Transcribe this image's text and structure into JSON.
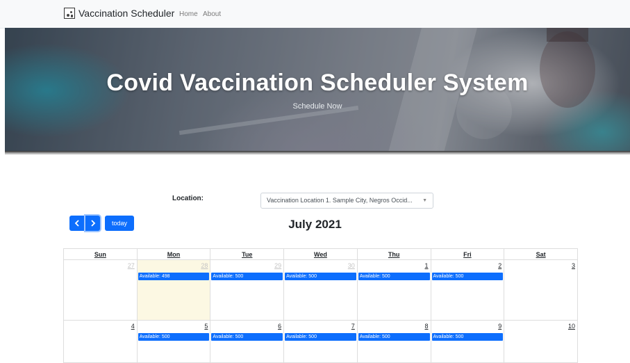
{
  "navbar": {
    "brand": "Vaccination Scheduler",
    "links": [
      "Home",
      "About"
    ]
  },
  "hero": {
    "title": "Covid Vaccination Scheduler System",
    "subtitle": "Schedule Now"
  },
  "location": {
    "label": "Location:",
    "selected": "Vaccination Location 1. Sample City, Negros Occid..."
  },
  "toolbar": {
    "prev_icon": "chevron-left",
    "next_icon": "chevron-right",
    "prev_label": "‹",
    "next_label": "›",
    "today_label": "today",
    "title": "July 2021"
  },
  "calendar": {
    "headers": [
      "Sun",
      "Mon",
      "Tue",
      "Wed",
      "Thu",
      "Fri",
      "Sat"
    ],
    "weeks": [
      [
        {
          "day": "27",
          "event": ""
        },
        {
          "day": "28",
          "event": "Available: 498"
        },
        {
          "day": "29",
          "event": "Available: 500"
        },
        {
          "day": "30",
          "event": "Available: 500"
        },
        {
          "day": "1",
          "event": "Available: 500"
        },
        {
          "day": "2",
          "event": "Available: 500"
        },
        {
          "day": "3",
          "event": ""
        }
      ],
      [
        {
          "day": "4",
          "event": ""
        },
        {
          "day": "5",
          "event": "Available: 500"
        },
        {
          "day": "6",
          "event": "Available: 500"
        },
        {
          "day": "7",
          "event": "Available: 500"
        },
        {
          "day": "8",
          "event": "Available: 500"
        },
        {
          "day": "9",
          "event": "Available: 500"
        },
        {
          "day": "10",
          "event": ""
        }
      ]
    ]
  },
  "colors": {
    "primary": "#0d6efd",
    "today_bg": "#fcf8e3"
  }
}
